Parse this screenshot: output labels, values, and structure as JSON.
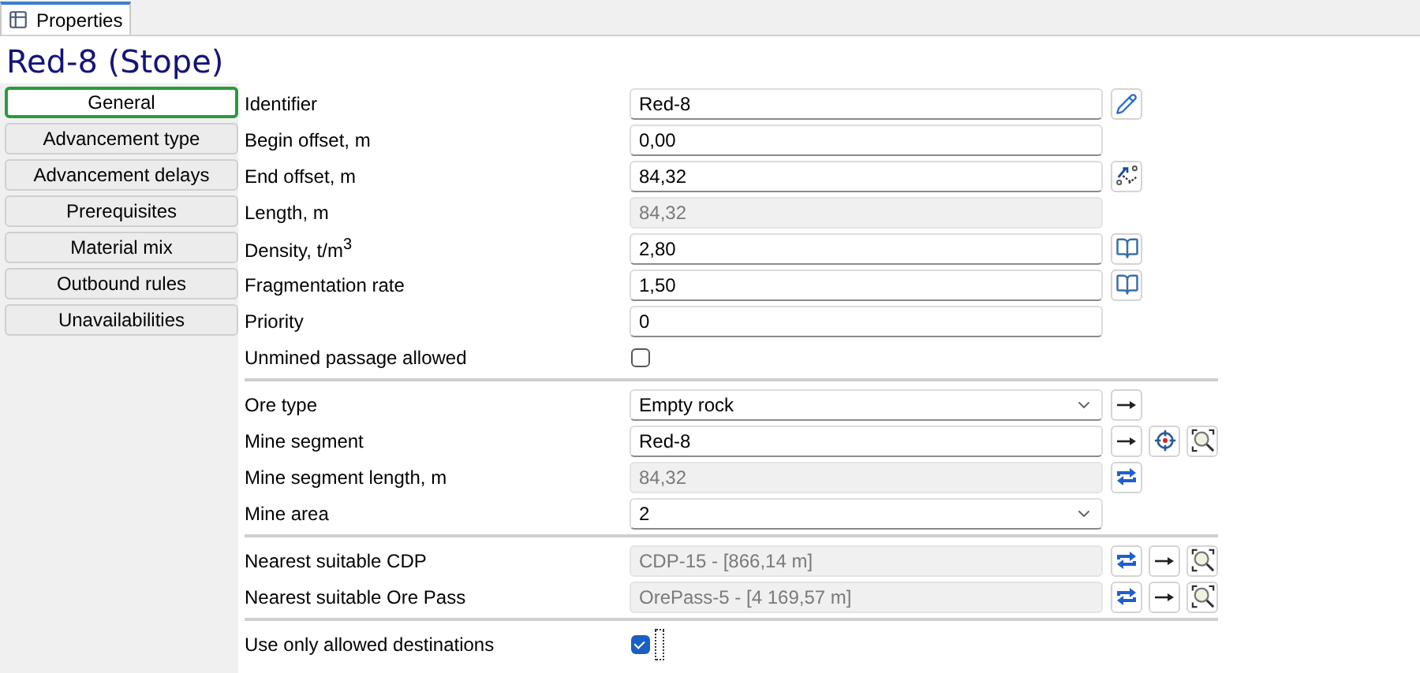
{
  "tab": {
    "label": "Properties",
    "selected": true
  },
  "title": "Red-8 (Stope)",
  "sidebar": [
    {
      "label": "General",
      "selected": true
    },
    {
      "label": "Advancement type",
      "selected": false
    },
    {
      "label": "Advancement delays",
      "selected": false
    },
    {
      "label": "Prerequisites",
      "selected": false
    },
    {
      "label": "Material mix",
      "selected": false
    },
    {
      "label": "Outbound rules",
      "selected": false
    },
    {
      "label": "Unavailabilities",
      "selected": false
    }
  ],
  "sections": [
    {
      "rows": [
        {
          "label": "Identifier",
          "kind": "text",
          "value": "Red-8",
          "actions": [
            {
              "kind": "pencil"
            }
          ]
        },
        {
          "label": "Begin offset, m",
          "kind": "text",
          "value": "0,00",
          "actions": []
        },
        {
          "label": "End offset, m",
          "kind": "text",
          "value": "84,32",
          "actions": [
            {
              "kind": "measure"
            }
          ]
        },
        {
          "label": "Length, m",
          "kind": "readonly",
          "value": "84,32",
          "actions": []
        },
        {
          "label": "Density, t/m$^{3}$",
          "kind": "text",
          "value": "2,80",
          "actions": [
            {
              "kind": "book"
            }
          ]
        },
        {
          "label": "Fragmentation rate",
          "kind": "text",
          "value": "1,50",
          "actions": [
            {
              "kind": "book"
            }
          ]
        },
        {
          "label": "Priority",
          "kind": "text",
          "value": "0",
          "actions": []
        },
        {
          "label": "Unmined passage allowed",
          "kind": "checkbox",
          "checked": false,
          "actions": []
        }
      ]
    },
    {
      "rows": [
        {
          "label": "Ore type",
          "kind": "select",
          "value": "Empty rock",
          "actions": [
            {
              "kind": "arrow"
            }
          ]
        },
        {
          "label": "Mine segment",
          "kind": "text",
          "value": "Red-8",
          "actions": [
            {
              "kind": "arrow"
            },
            {
              "kind": "target"
            },
            {
              "kind": "zoom"
            }
          ]
        },
        {
          "label": "Mine segment length, m",
          "kind": "readonly",
          "value": "84,32",
          "actions": [
            {
              "kind": "refresh"
            }
          ]
        },
        {
          "label": "Mine area",
          "kind": "select",
          "value": "2",
          "actions": []
        }
      ]
    },
    {
      "rows": [
        {
          "label": "Nearest suitable CDP",
          "kind": "readonly",
          "value": "CDP-15 - [866,14 m]",
          "actions": [
            {
              "kind": "refresh"
            },
            {
              "kind": "arrow"
            },
            {
              "kind": "zoom"
            }
          ]
        },
        {
          "label": "Nearest suitable Ore Pass",
          "kind": "readonly",
          "value": "OrePass-5 - [4 169,57 m]",
          "actions": [
            {
              "kind": "refresh"
            },
            {
              "kind": "arrow"
            },
            {
              "kind": "zoom"
            }
          ]
        }
      ]
    },
    {
      "rows": [
        {
          "label": "Use only allowed destinations",
          "kind": "checkbox",
          "checked": true,
          "actions": []
        }
      ]
    }
  ]
}
